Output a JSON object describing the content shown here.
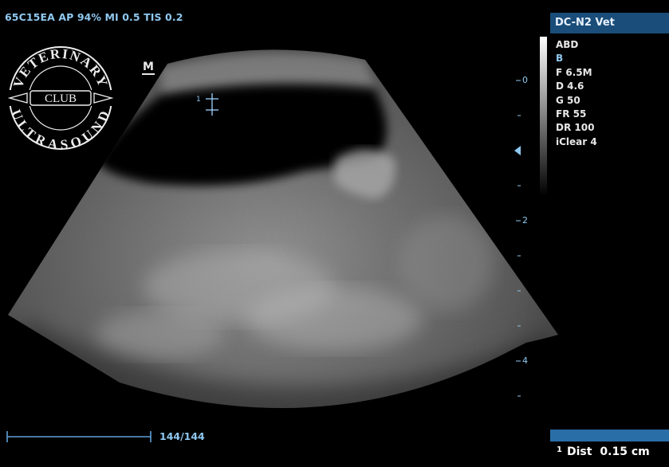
{
  "header": {
    "info": "65C15EA AP 94% MI 0.5 TIS 0.2"
  },
  "logo": {
    "top_text": "VETERINARY",
    "center_text": "CLUB",
    "bottom_text": "ULTRASOUND"
  },
  "image": {
    "marker": "M",
    "caliper_label": "1"
  },
  "side_panel": {
    "title": "DC-N2 Vet",
    "preset": "ABD",
    "mode": "B",
    "params": [
      "F 6.5M",
      "D 4.6",
      "G 50",
      "FR 55",
      "DR 100",
      "iClear 4"
    ]
  },
  "depth_scale": {
    "labels": [
      "0",
      "2",
      "4"
    ]
  },
  "cine": {
    "frame_count": "144/144"
  },
  "measurement": {
    "index": "1",
    "label": "Dist",
    "value": "0.15 cm"
  },
  "colors": {
    "accent": "#8fc8f0",
    "panel_header": "#1a4d79",
    "measure_bar": "#2a6ea7"
  }
}
